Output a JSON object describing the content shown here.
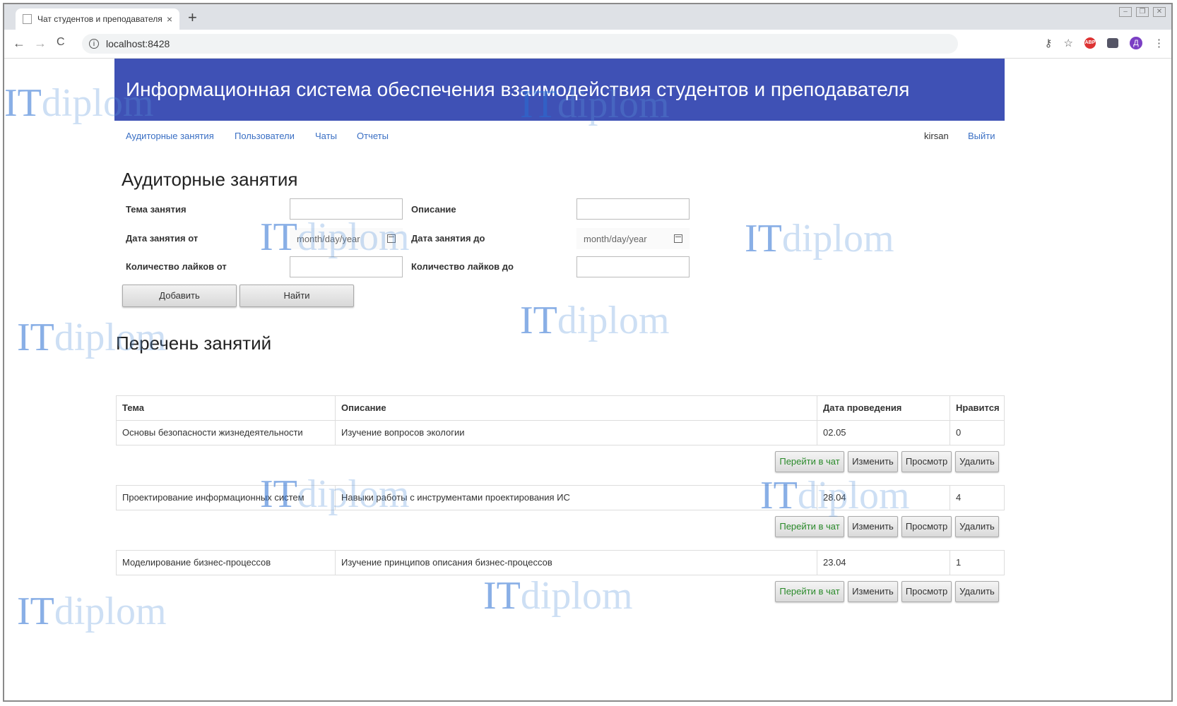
{
  "browser": {
    "tab_title": "Чат студентов и преподавателя",
    "tab_close": "×",
    "new_tab": "+",
    "back": "←",
    "forward": "→",
    "reload": "C",
    "url": "localhost:8428",
    "info_glyph": "i",
    "key_glyph": "⚷",
    "star_glyph": "☆",
    "adblock_label": "ABP",
    "avatar_letter": "Д",
    "menu_glyph": "⋮"
  },
  "header": {
    "title": "Информационная система обеспечения взаимодействия студентов и преподавателя"
  },
  "nav": {
    "items": [
      "Аудиторные занятия",
      "Пользователи",
      "Чаты",
      "Отчеты"
    ],
    "username": "kirsan",
    "logout": "Выйти"
  },
  "form": {
    "title": "Аудиторные занятия",
    "topic_label": "Тема занятия",
    "desc_label": "Описание",
    "date_from_label": "Дата занятия от",
    "date_to_label": "Дата занятия до",
    "likes_from_label": "Количество лайков от",
    "likes_to_label": "Количество лайков до",
    "date_placeholder": "month/day/year",
    "add_button": "Добавить",
    "find_button": "Найти"
  },
  "list": {
    "title": "Перечень занятий",
    "columns": [
      "Тема",
      "Описание",
      "Дата проведения",
      "Нравится"
    ],
    "rows": [
      {
        "topic": "Основы безопасности жизнедеятельности",
        "description": "Изучение вопросов экологии",
        "date": "02.05",
        "likes": "0"
      },
      {
        "topic": "Проектирование информационных систем",
        "description": "Навыки работы с инструментами проектирования ИС",
        "date": "28.04",
        "likes": "4"
      },
      {
        "topic": "Моделирование бизнес-процессов",
        "description": "Изучение принципов описания бизнес-процессов",
        "date": "23.04",
        "likes": "1"
      }
    ],
    "actions": {
      "chat": "Перейти в чат",
      "edit": "Изменить",
      "view": "Просмотр",
      "delete": "Удалить"
    }
  },
  "watermark": {
    "it": "IT",
    "diplom": "diplom"
  },
  "colors": {
    "banner": "#3f51b5",
    "link": "#3a6fc4",
    "chat_button_text": "#2a8a2a"
  }
}
